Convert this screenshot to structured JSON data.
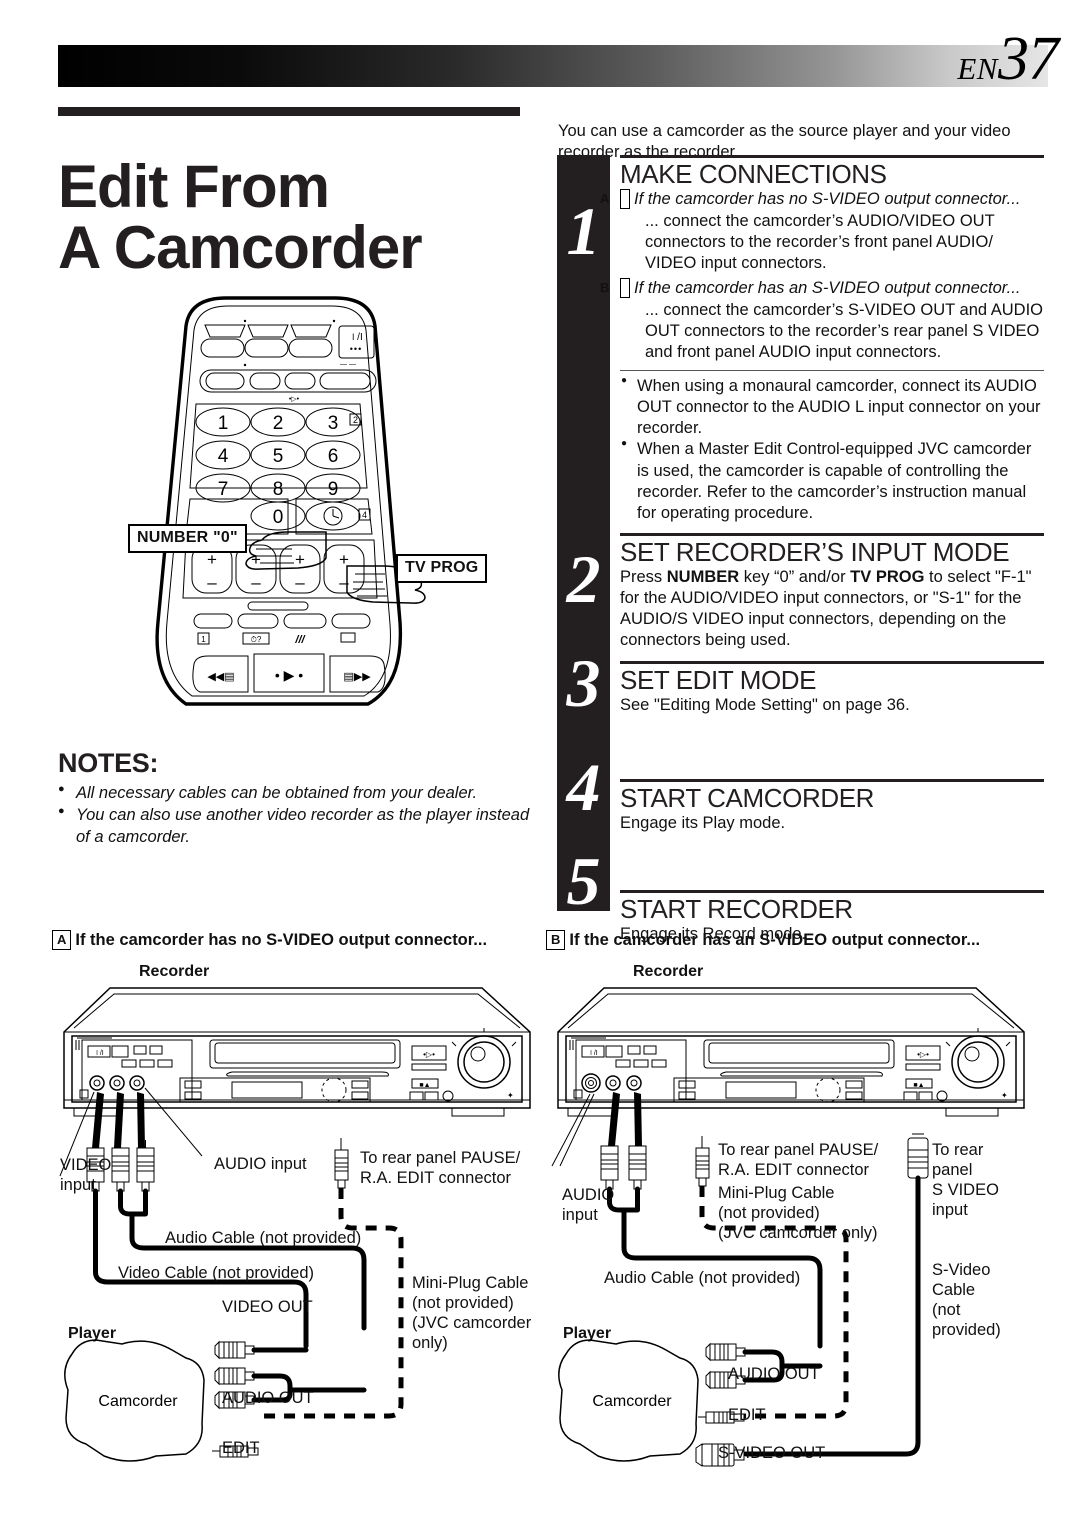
{
  "header": {
    "lang": "EN",
    "page_number": "37"
  },
  "title": {
    "line1": "Edit From",
    "line2": "A Camcorder"
  },
  "intro": "You can use a camcorder as the source player and your video recorder as the recorder.",
  "remote": {
    "callout_number": "NUMBER \"0\"",
    "callout_tvprog": "TV PROG",
    "keys": [
      "1",
      "2",
      "3",
      "4",
      "5",
      "6",
      "7",
      "8",
      "9",
      "0"
    ],
    "marker_2": "2",
    "marker_4": "4",
    "plus": "+",
    "minus": "–"
  },
  "steps": [
    {
      "num": "1",
      "heading": "MAKE CONNECTIONS",
      "a_label": "A",
      "a_title": "If the camcorder has no S-VIDEO output connector...",
      "a_body": "... connect the camcorder’s AUDIO/VIDEO OUT connectors to the recorder’s front panel AUDIO/ VIDEO input connectors.",
      "b_label": "B",
      "b_title": "If the camcorder has an S-VIDEO output connector...",
      "b_body": "... connect the camcorder’s S-VIDEO OUT and AUDIO OUT connectors to the recorder’s rear panel S VIDEO and front panel AUDIO input connectors.",
      "bullets": [
        "When using a monaural camcorder, connect its AUDIO OUT connector to the AUDIO L input connector on your recorder.",
        "When a Master Edit Control-equipped JVC camcorder is used, the camcorder is capable of controlling the recorder. Refer to the camcorder’s instruction manual for operating procedure."
      ]
    },
    {
      "num": "2",
      "heading": "SET RECORDER’S INPUT MODE",
      "body_p1": "Press ",
      "body_b1": "NUMBER",
      "body_p2": " key “0” and/or ",
      "body_b2": "TV PROG",
      "body_p3": " to select \"F-1\" for the AUDIO/VIDEO input connectors, or \"S-1\" for the AUDIO/S VIDEO input connectors, depending on the connectors being used."
    },
    {
      "num": "3",
      "heading": "SET EDIT MODE",
      "body": "See \"Editing Mode Setting\" on page 36."
    },
    {
      "num": "4",
      "heading": "START CAMCORDER",
      "body": "Engage its Play mode."
    },
    {
      "num": "5",
      "heading": "START RECORDER",
      "body": "Engage its Record mode."
    }
  ],
  "notes": {
    "heading": "NOTES:",
    "items": [
      "All necessary cables can be obtained from your dealer.",
      "You can also use another video recorder as the player instead of a camcorder."
    ]
  },
  "diagram_a": {
    "label": "A",
    "heading": "If the camcorder has no S-VIDEO output connector...",
    "recorder": "Recorder",
    "player": "Player",
    "camcorder": "Camcorder",
    "video_input": "VIDEO\ninput",
    "audio_input": "AUDIO input",
    "pause_edit": "To rear panel PAUSE/\nR.A. EDIT connector",
    "audio_cable": "Audio Cable (not provided)",
    "video_cable": "Video Cable (not provided)",
    "mini_plug": "Mini-Plug Cable\n(not provided)\n(JVC camcorder\nonly)",
    "video_out": "VIDEO OUT",
    "audio_out": "AUDIO OUT",
    "edit": "EDIT"
  },
  "diagram_b": {
    "label": "B",
    "heading": "If the camcorder has an S-VIDEO output connector...",
    "recorder": "Recorder",
    "player": "Player",
    "camcorder": "Camcorder",
    "audio_input": "AUDIO\ninput",
    "pause_edit": "To rear panel PAUSE/\nR.A. EDIT connector",
    "mini_plug": "Mini-Plug Cable\n(not provided)\n(JVC camcorder only)",
    "svideo_input": "To rear\npanel\nS VIDEO\ninput",
    "svideo_cable": "S-Video\nCable\n(not\nprovided)",
    "audio_cable": "Audio Cable (not provided)",
    "audio_out": "AUDIO OUT",
    "edit": "EDIT",
    "svideo_out": "S-VIDEO OUT"
  },
  "colors": {
    "ink": "#231f20",
    "paper": "#ffffff"
  }
}
